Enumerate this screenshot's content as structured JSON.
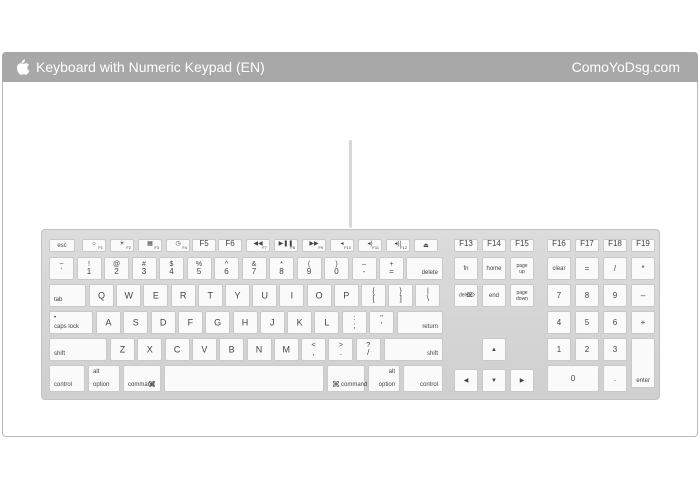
{
  "banner": {
    "title": "Keyboard with Numeric Keypad (EN)",
    "site": "ComoYoDsg.com",
    "logo_icon": "apple-logo-icon",
    "bg_color": "#a8a8a8"
  },
  "keyboard": {
    "keys": [
      {
        "id": "esc",
        "layout": "c",
        "c": "esc"
      },
      {
        "id": "f1",
        "layout": "icon-f",
        "icon": "brightness-down-icon",
        "glyph": "☼",
        "f": "F1"
      },
      {
        "id": "f2",
        "layout": "icon-f",
        "icon": "brightness-up-icon",
        "glyph": "☀",
        "f": "F2"
      },
      {
        "id": "f3",
        "layout": "icon-f",
        "icon": "expose-icon",
        "glyph": "▦",
        "f": "F3"
      },
      {
        "id": "f4",
        "layout": "icon-f",
        "icon": "dashboard-icon",
        "glyph": "◷",
        "f": "F4"
      },
      {
        "id": "f5",
        "layout": "f",
        "f": "F5"
      },
      {
        "id": "f6",
        "layout": "f",
        "f": "F6"
      },
      {
        "id": "f7",
        "layout": "icon-f",
        "icon": "rewind-icon",
        "glyph": "◀◀",
        "f": "F7"
      },
      {
        "id": "f8",
        "layout": "icon-f",
        "icon": "play-pause-icon",
        "glyph": "▶❚❚",
        "f": "F8"
      },
      {
        "id": "f9",
        "layout": "icon-f",
        "icon": "fast-forward-icon",
        "glyph": "▶▶",
        "f": "F9"
      },
      {
        "id": "f10",
        "layout": "icon-f",
        "icon": "mute-icon",
        "glyph": "◂",
        "f": "F10"
      },
      {
        "id": "f11",
        "layout": "icon-f",
        "icon": "volume-down-icon",
        "glyph": "◂)",
        "f": "F11"
      },
      {
        "id": "f12",
        "layout": "icon-f",
        "icon": "volume-up-icon",
        "glyph": "◂))",
        "f": "F12"
      },
      {
        "id": "eject",
        "layout": "icon",
        "icon": "eject-icon",
        "glyph": "⏏"
      },
      {
        "id": "f13",
        "layout": "f",
        "f": "F13"
      },
      {
        "id": "f14",
        "layout": "f",
        "f": "F14"
      },
      {
        "id": "f15",
        "layout": "f",
        "f": "F15"
      },
      {
        "id": "f16",
        "layout": "f",
        "f": "F16"
      },
      {
        "id": "f17",
        "layout": "f",
        "f": "F17"
      },
      {
        "id": "f18",
        "layout": "f",
        "f": "F18"
      },
      {
        "id": "f19",
        "layout": "f",
        "f": "F19"
      },
      {
        "id": "grave",
        "layout": "tb",
        "t": "~",
        "b": "`"
      },
      {
        "id": "k1",
        "layout": "tb",
        "t": "!",
        "b": "1"
      },
      {
        "id": "k2",
        "layout": "tb",
        "t": "@",
        "b": "2"
      },
      {
        "id": "k3",
        "layout": "tb",
        "t": "#",
        "b": "3"
      },
      {
        "id": "k4",
        "layout": "tb",
        "t": "$",
        "b": "4"
      },
      {
        "id": "k5",
        "layout": "tb",
        "t": "%",
        "b": "5"
      },
      {
        "id": "k6",
        "layout": "tb",
        "t": "^",
        "b": "6"
      },
      {
        "id": "k7",
        "layout": "tb",
        "t": "&",
        "b": "7"
      },
      {
        "id": "k8",
        "layout": "tb",
        "t": "*",
        "b": "8"
      },
      {
        "id": "k9",
        "layout": "tb",
        "t": "(",
        "b": "9"
      },
      {
        "id": "k0",
        "layout": "tb",
        "t": ")",
        "b": "0"
      },
      {
        "id": "minus",
        "layout": "tb",
        "t": "–",
        "b": "-"
      },
      {
        "id": "equal",
        "layout": "tb",
        "t": "+",
        "b": "="
      },
      {
        "id": "delete",
        "layout": "br",
        "br": "delete"
      },
      {
        "id": "fnkey",
        "layout": "c",
        "c": "fn"
      },
      {
        "id": "home",
        "layout": "c",
        "c": "home"
      },
      {
        "id": "pageup",
        "layout": "two",
        "l1": "page",
        "l2": "up"
      },
      {
        "id": "clear",
        "layout": "c",
        "c": "clear"
      },
      {
        "id": "npeq",
        "layout": "c",
        "c": "="
      },
      {
        "id": "npdiv",
        "layout": "c",
        "c": "/"
      },
      {
        "id": "npmul",
        "layout": "c",
        "c": "*"
      },
      {
        "id": "tab",
        "layout": "bl",
        "bl": "tab"
      },
      {
        "id": "q",
        "layout": "c",
        "c": "Q"
      },
      {
        "id": "w",
        "layout": "c",
        "c": "W"
      },
      {
        "id": "e",
        "layout": "c",
        "c": "E"
      },
      {
        "id": "r",
        "layout": "c",
        "c": "R"
      },
      {
        "id": "t",
        "layout": "c",
        "c": "T"
      },
      {
        "id": "y",
        "layout": "c",
        "c": "Y"
      },
      {
        "id": "u",
        "layout": "c",
        "c": "U"
      },
      {
        "id": "i",
        "layout": "c",
        "c": "I"
      },
      {
        "id": "o",
        "layout": "c",
        "c": "O"
      },
      {
        "id": "p",
        "layout": "c",
        "c": "P"
      },
      {
        "id": "lbrace",
        "layout": "tb",
        "t": "{",
        "b": "["
      },
      {
        "id": "rbrace",
        "layout": "tb",
        "t": "}",
        "b": "]"
      },
      {
        "id": "pipe",
        "layout": "tb",
        "t": "|",
        "b": "\\"
      },
      {
        "id": "delfwd",
        "layout": "icon-text",
        "text": "delete",
        "glyph": "⌦",
        "icon": "forward-delete-icon"
      },
      {
        "id": "end",
        "layout": "c",
        "c": "end"
      },
      {
        "id": "pagedown",
        "layout": "two",
        "l1": "page",
        "l2": "down"
      },
      {
        "id": "np7",
        "layout": "c",
        "c": "7"
      },
      {
        "id": "np8",
        "layout": "c",
        "c": "8"
      },
      {
        "id": "np9",
        "layout": "c",
        "c": "9"
      },
      {
        "id": "npminus",
        "layout": "c",
        "c": "–"
      },
      {
        "id": "capslock",
        "layout": "tlbl",
        "tl": "•",
        "bl": "caps lock"
      },
      {
        "id": "a",
        "layout": "c",
        "c": "A"
      },
      {
        "id": "s",
        "layout": "c",
        "c": "S"
      },
      {
        "id": "d",
        "layout": "c",
        "c": "D"
      },
      {
        "id": "f",
        "layout": "c",
        "c": "F"
      },
      {
        "id": "g",
        "layout": "c",
        "c": "G"
      },
      {
        "id": "h",
        "layout": "c",
        "c": "H"
      },
      {
        "id": "j",
        "layout": "c",
        "c": "J"
      },
      {
        "id": "k",
        "layout": "c",
        "c": "K"
      },
      {
        "id": "l",
        "layout": "c",
        "c": "L"
      },
      {
        "id": "semicolon",
        "layout": "tb",
        "t": ":",
        "b": ";"
      },
      {
        "id": "quote",
        "layout": "tb",
        "t": "\"",
        "b": "'"
      },
      {
        "id": "return",
        "layout": "br",
        "br": "return"
      },
      {
        "id": "np4",
        "layout": "c",
        "c": "4"
      },
      {
        "id": "np5",
        "layout": "c",
        "c": "5"
      },
      {
        "id": "np6",
        "layout": "c",
        "c": "6"
      },
      {
        "id": "npplus",
        "layout": "c",
        "c": "+"
      },
      {
        "id": "lshift",
        "layout": "bl",
        "bl": "shift"
      },
      {
        "id": "z",
        "layout": "c",
        "c": "Z"
      },
      {
        "id": "x",
        "layout": "c",
        "c": "X"
      },
      {
        "id": "cc",
        "layout": "c",
        "c": "C"
      },
      {
        "id": "v",
        "layout": "c",
        "c": "V"
      },
      {
        "id": "bb",
        "layout": "c",
        "c": "B"
      },
      {
        "id": "n",
        "layout": "c",
        "c": "N"
      },
      {
        "id": "m",
        "layout": "c",
        "c": "M"
      },
      {
        "id": "comma",
        "layout": "tb",
        "t": "<",
        "b": ","
      },
      {
        "id": "period",
        "layout": "tb",
        "t": ">",
        "b": "."
      },
      {
        "id": "slash",
        "layout": "tb",
        "t": "?",
        "b": "/"
      },
      {
        "id": "rshift",
        "layout": "br",
        "br": "shift"
      },
      {
        "id": "up",
        "layout": "icon",
        "icon": "arrow-up-icon",
        "glyph": "▲"
      },
      {
        "id": "np1",
        "layout": "c",
        "c": "1"
      },
      {
        "id": "np2",
        "layout": "c",
        "c": "2"
      },
      {
        "id": "np3",
        "layout": "c",
        "c": "3"
      },
      {
        "id": "enter",
        "layout": "br",
        "br": "enter"
      },
      {
        "id": "lcontrol",
        "layout": "bl",
        "bl": "control"
      },
      {
        "id": "loption",
        "layout": "tlbl",
        "tl": "alt",
        "bl": "option"
      },
      {
        "id": "lcommand",
        "layout": "blicon",
        "bl": "command",
        "glyph": "⌘",
        "icon": "command-icon"
      },
      {
        "id": "space",
        "layout": "none"
      },
      {
        "id": "rcommand",
        "layout": "iconbl",
        "bl": "command",
        "glyph": "⌘",
        "icon": "command-icon"
      },
      {
        "id": "roption",
        "layout": "trbr",
        "tr": "alt",
        "br": "option"
      },
      {
        "id": "rcontrol",
        "layout": "br",
        "br": "control"
      },
      {
        "id": "left",
        "layout": "icon",
        "icon": "arrow-left-icon",
        "glyph": "◀"
      },
      {
        "id": "down",
        "layout": "icon",
        "icon": "arrow-down-icon",
        "glyph": "▼"
      },
      {
        "id": "right",
        "layout": "icon",
        "icon": "arrow-right-icon",
        "glyph": "▶"
      },
      {
        "id": "np0",
        "layout": "c",
        "c": "0"
      },
      {
        "id": "npdot",
        "layout": "c",
        "c": "."
      }
    ]
  }
}
